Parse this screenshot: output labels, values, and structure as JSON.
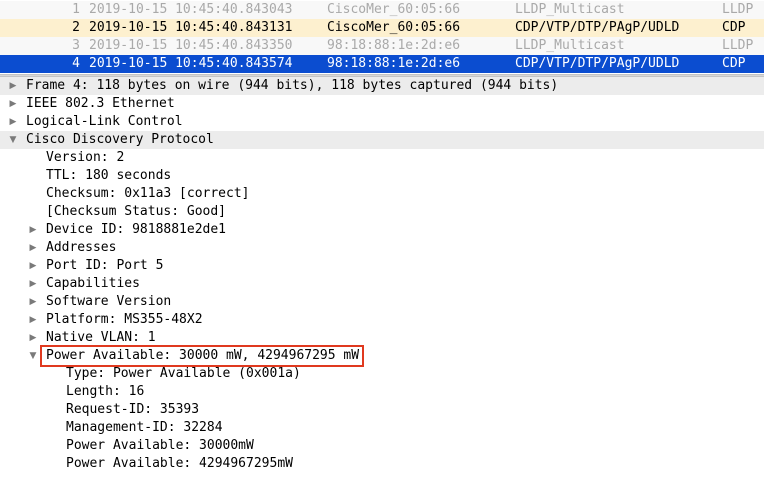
{
  "packets": [
    {
      "no": "1",
      "time": "2019-10-15 10:45:40.843043",
      "source": "CiscoMer_60:05:66",
      "destination": "LLDP_Multicast",
      "protocol": "LLDP",
      "style": "lldp"
    },
    {
      "no": "2",
      "time": "2019-10-15 10:45:40.843131",
      "source": "CiscoMer_60:05:66",
      "destination": "CDP/VTP/DTP/PAgP/UDLD",
      "protocol": "CDP",
      "style": "cdp"
    },
    {
      "no": "3",
      "time": "2019-10-15 10:45:40.843350",
      "source": "98:18:88:1e:2d:e6",
      "destination": "LLDP_Multicast",
      "protocol": "LLDP",
      "style": "lldp"
    },
    {
      "no": "4",
      "time": "2019-10-15 10:45:40.843574",
      "source": "98:18:88:1e:2d:e6",
      "destination": "CDP/VTP/DTP/PAgP/UDLD",
      "protocol": "CDP",
      "style": "selected"
    }
  ],
  "colors": {
    "lldp_bg": "#f8f8f8",
    "lldp_fg": "#a9a9a9",
    "cdp_bg": "#fdf0cf",
    "cdp_fg": "#000000",
    "selected_bg": "#0b4dd0",
    "selected_fg": "#ffffff",
    "top_level_bg": "#ececec",
    "highlight": "#e0391f"
  },
  "details": {
    "frame": "Frame 4: 118 bytes on wire (944 bits), 118 bytes captured (944 bits)",
    "ethernet": "IEEE 802.3 Ethernet",
    "llc": "Logical-Link Control",
    "cdp": "Cisco Discovery Protocol",
    "version": "Version: 2",
    "ttl": "TTL: 180 seconds",
    "checksum": "Checksum: 0x11a3 [correct]",
    "checksum_status": "[Checksum Status: Good]",
    "device_id": "Device ID: 9818881e2de1",
    "addresses": "Addresses",
    "port_id": "Port ID: Port 5",
    "capabilities": "Capabilities",
    "software_version": "Software Version",
    "platform": "Platform: MS355-48X2",
    "native_vlan": "Native VLAN: 1",
    "power_available": "Power Available: 30000 mW, 4294967295 mW",
    "pa_type": "Type: Power Available (0x001a)",
    "pa_length": "Length: 16",
    "pa_request_id": "Request-ID: 35393",
    "pa_management_id": "Management-ID: 32284",
    "pa_power_1": "Power Available: 30000mW",
    "pa_power_2": "Power Available: 4294967295mW"
  }
}
